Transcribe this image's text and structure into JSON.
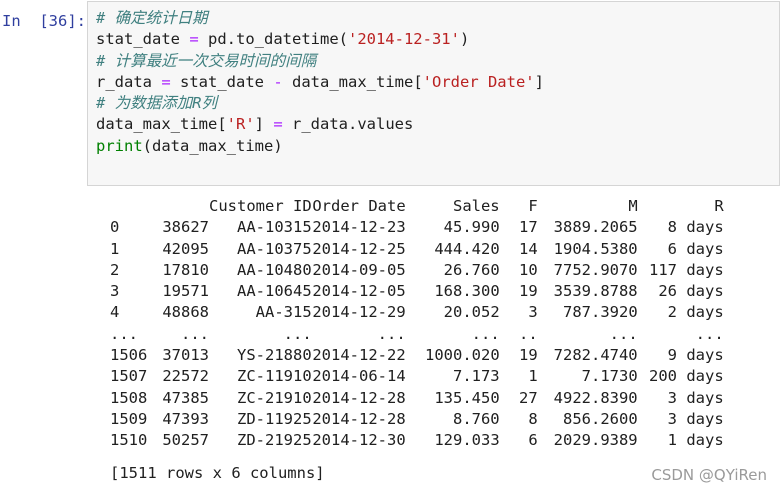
{
  "cell": {
    "prompt": "In  [36]:",
    "code_lines": [
      [
        {
          "t": "# 确定统计日期",
          "c": "cm"
        }
      ],
      [
        {
          "t": "stat_date ",
          "c": ""
        },
        {
          "t": "=",
          "c": "op"
        },
        {
          "t": " pd.to_datetime(",
          "c": ""
        },
        {
          "t": "'2014-12-31'",
          "c": "st"
        },
        {
          "t": ")",
          "c": ""
        }
      ],
      [
        {
          "t": "# 计算最近一次交易时间的间隔",
          "c": "cm"
        }
      ],
      [
        {
          "t": "r_data ",
          "c": ""
        },
        {
          "t": "=",
          "c": "op"
        },
        {
          "t": " stat_date ",
          "c": ""
        },
        {
          "t": "-",
          "c": "op"
        },
        {
          "t": " data_max_time[",
          "c": ""
        },
        {
          "t": "'Order Date'",
          "c": "st"
        },
        {
          "t": "]",
          "c": ""
        }
      ],
      [
        {
          "t": "# 为数据添加R列",
          "c": "cm"
        }
      ],
      [
        {
          "t": "data_max_time[",
          "c": ""
        },
        {
          "t": "'R'",
          "c": "st"
        },
        {
          "t": "] ",
          "c": ""
        },
        {
          "t": "=",
          "c": "op"
        },
        {
          "t": " r_data.values",
          "c": ""
        }
      ],
      [
        {
          "t": "print",
          "c": "bi"
        },
        {
          "t": "(data_max_time)",
          "c": ""
        }
      ]
    ]
  },
  "output": {
    "columns": [
      "",
      "",
      "Customer ID",
      "Order Date",
      "Sales",
      "F",
      "M",
      "R"
    ],
    "rows": [
      [
        "0",
        "38627",
        "AA-10315",
        "2014-12-23",
        "45.990",
        "17",
        "3889.2065",
        "8 days"
      ],
      [
        "1",
        "42095",
        "AA-10375",
        "2014-12-25",
        "444.420",
        "14",
        "1904.5380",
        "6 days"
      ],
      [
        "2",
        "17810",
        "AA-10480",
        "2014-09-05",
        "26.760",
        "10",
        "7752.9070",
        "117 days"
      ],
      [
        "3",
        "19571",
        "AA-10645",
        "2014-12-05",
        "168.300",
        "19",
        "3539.8788",
        "26 days"
      ],
      [
        "4",
        "48868",
        "AA-315",
        "2014-12-29",
        "20.052",
        "3",
        "787.3920",
        "2 days"
      ],
      [
        "...",
        "...",
        "...",
        "...",
        "...",
        "..",
        "...",
        "..."
      ],
      [
        "1506",
        "37013",
        "YS-21880",
        "2014-12-22",
        "1000.020",
        "19",
        "7282.4740",
        "9 days"
      ],
      [
        "1507",
        "22572",
        "ZC-11910",
        "2014-06-14",
        "7.173",
        "1",
        "7.1730",
        "200 days"
      ],
      [
        "1508",
        "47385",
        "ZC-21910",
        "2014-12-28",
        "135.450",
        "27",
        "4922.8390",
        "3 days"
      ],
      [
        "1509",
        "47393",
        "ZD-11925",
        "2014-12-28",
        "8.760",
        "8",
        "856.2600",
        "3 days"
      ],
      [
        "1510",
        "50257",
        "ZD-21925",
        "2014-12-30",
        "129.033",
        "6",
        "2029.9389",
        "1 days"
      ]
    ],
    "summary": "[1511 rows x 6 columns]"
  },
  "watermark": "CSDN @QYiRen"
}
